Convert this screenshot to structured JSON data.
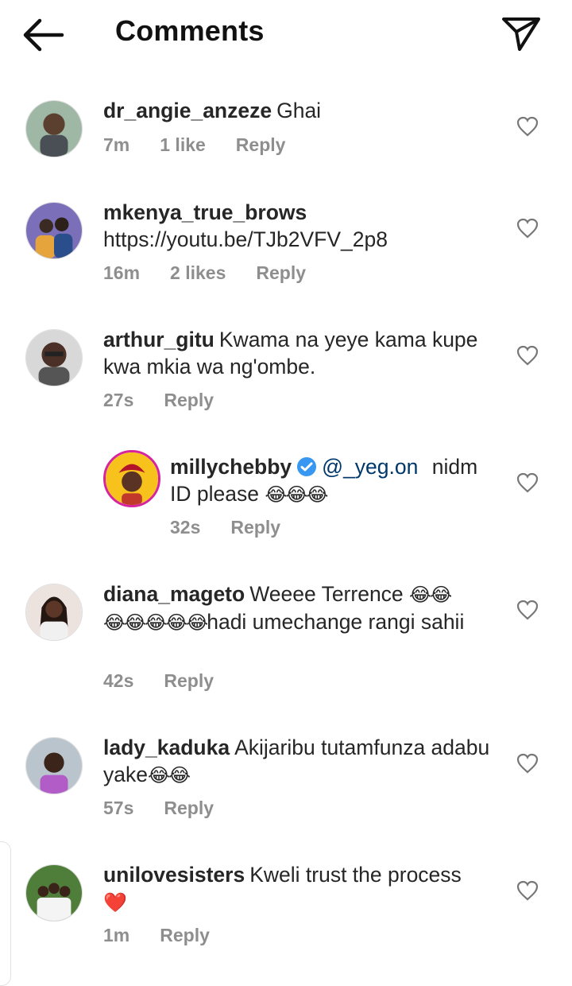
{
  "header": {
    "title": "Comments",
    "back_icon": "arrow-left-icon",
    "send_icon": "paper-plane-icon"
  },
  "comments": [
    {
      "username": "dr_angie_anzeze",
      "text": "Ghai",
      "time": "7m",
      "likes": "1 like",
      "reply": "Reply"
    },
    {
      "username": "mkenya_true_brows",
      "text": "https://youtu.be/TJb2VFV_2p8",
      "time": "16m",
      "likes": "2 likes",
      "reply": "Reply"
    },
    {
      "username": "arthur_gitu",
      "text": "Kwama na yeye kama kupe kwa mkia wa ng'ombe.",
      "time": "27s",
      "reply": "Reply"
    },
    {
      "username": "millychebby",
      "verified": true,
      "mention": "@_yeg.on",
      "text_line1": "nidm",
      "text_line2": "ID please ",
      "emoji": "😂😂😂",
      "time": "32s",
      "reply": "Reply"
    },
    {
      "username": "diana_mageto",
      "text_a": "Weeee Terrence ",
      "emoji_a": "😂😂",
      "emoji_b": "😂😂😂😂😂",
      "text_b": "hadi umechange rangi sahii",
      "time": "42s",
      "reply": "Reply"
    },
    {
      "username": "lady_kaduka",
      "text_a": "Akijaribu tutamfunza adabu yake",
      "emoji": "😂😂",
      "time": "57s",
      "reply": "Reply"
    },
    {
      "username": "unilovesisters",
      "text": "Kweli trust the process",
      "emoji": "❤️",
      "time": "1m",
      "reply": "Reply"
    }
  ],
  "colors": {
    "username": "#262626",
    "meta": "#8e8e8e",
    "mention": "#00376b",
    "verified": "#3897f0",
    "heart_red": "#e0245e"
  }
}
